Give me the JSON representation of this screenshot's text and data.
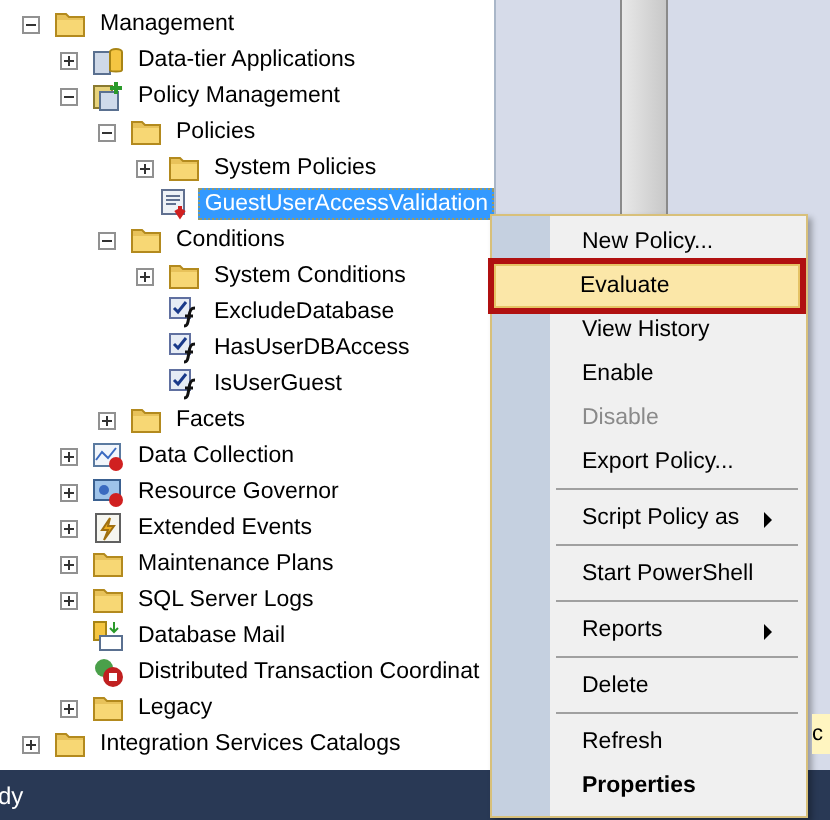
{
  "tree": [
    {
      "label": "Management",
      "kind": "folder",
      "expanded": true,
      "selected": false,
      "children": [
        {
          "label": "Data-tier Applications",
          "kind": "datatier",
          "expanded": false,
          "selected": false
        },
        {
          "label": "Policy Management",
          "kind": "policymgmt",
          "expanded": true,
          "selected": false,
          "children": [
            {
              "label": "Policies",
              "kind": "folder",
              "expanded": true,
              "selected": false,
              "children": [
                {
                  "label": "System Policies",
                  "kind": "folder",
                  "expanded": false,
                  "selected": false
                },
                {
                  "label": "GuestUserAccessValidation",
                  "kind": "policy",
                  "selected": true
                }
              ]
            },
            {
              "label": "Conditions",
              "kind": "folder",
              "expanded": true,
              "selected": false,
              "children": [
                {
                  "label": "System Conditions",
                  "kind": "folder",
                  "expanded": false,
                  "selected": false
                },
                {
                  "label": "ExcludeDatabase",
                  "kind": "condition",
                  "selected": false
                },
                {
                  "label": "HasUserDBAccess",
                  "kind": "condition",
                  "selected": false
                },
                {
                  "label": "IsUserGuest",
                  "kind": "condition",
                  "selected": false
                }
              ]
            },
            {
              "label": "Facets",
              "kind": "folder",
              "expanded": false,
              "selected": false
            }
          ]
        },
        {
          "label": "Data Collection",
          "kind": "datacollection",
          "expanded": false,
          "selected": false
        },
        {
          "label": "Resource Governor",
          "kind": "resourcegov",
          "expanded": false,
          "selected": false
        },
        {
          "label": "Extended Events",
          "kind": "events",
          "expanded": false,
          "selected": false
        },
        {
          "label": "Maintenance Plans",
          "kind": "folder",
          "expanded": false,
          "selected": false
        },
        {
          "label": "SQL Server Logs",
          "kind": "folder",
          "expanded": false,
          "selected": false
        },
        {
          "label": "Database Mail",
          "kind": "mail",
          "selected": false
        },
        {
          "label": "Distributed Transaction Coordinat",
          "kind": "dtc",
          "selected": false
        },
        {
          "label": "Legacy",
          "kind": "folder",
          "expanded": false,
          "selected": false
        }
      ]
    },
    {
      "label": "Integration Services Catalogs",
      "kind": "folder",
      "expanded": false,
      "selected": false
    }
  ],
  "context_menu": {
    "items": [
      {
        "kind": "item",
        "label": "New Policy...",
        "selected": false,
        "disabled": false
      },
      {
        "kind": "item",
        "label": "Evaluate",
        "selected": true,
        "disabled": false,
        "highlighted": true
      },
      {
        "kind": "item",
        "label": "View History",
        "selected": false,
        "disabled": false
      },
      {
        "kind": "item",
        "label": "Enable",
        "selected": false,
        "disabled": false
      },
      {
        "kind": "item",
        "label": "Disable",
        "selected": false,
        "disabled": true
      },
      {
        "kind": "item",
        "label": "Export Policy...",
        "selected": false,
        "disabled": false
      },
      {
        "kind": "separator"
      },
      {
        "kind": "submenu",
        "label": "Script Policy as",
        "selected": false,
        "disabled": false
      },
      {
        "kind": "separator"
      },
      {
        "kind": "item",
        "label": "Start PowerShell",
        "selected": false,
        "disabled": false
      },
      {
        "kind": "separator"
      },
      {
        "kind": "submenu",
        "label": "Reports",
        "selected": false,
        "disabled": false
      },
      {
        "kind": "separator"
      },
      {
        "kind": "item",
        "label": "Delete",
        "selected": false,
        "disabled": false
      },
      {
        "kind": "separator"
      },
      {
        "kind": "item",
        "label": "Refresh",
        "selected": false,
        "disabled": false
      },
      {
        "kind": "item",
        "label": "Properties",
        "selected": false,
        "disabled": false,
        "default": true
      }
    ]
  },
  "side_tab": {
    "label": "c"
  },
  "status_bar": {
    "text": "dy"
  }
}
